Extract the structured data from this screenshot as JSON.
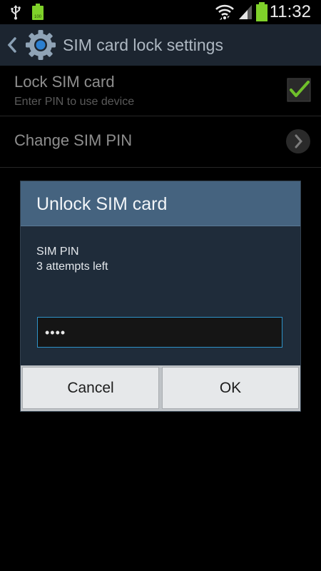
{
  "status_bar": {
    "time": "11:32",
    "icons": [
      "usb-icon",
      "battery-full-icon",
      "wifi-icon",
      "signal-icon",
      "battery-icon"
    ],
    "battery_color": "#7fd12a"
  },
  "action_bar": {
    "title": "SIM card lock settings",
    "icons": [
      "back-icon",
      "settings-gear-icon"
    ]
  },
  "settings": {
    "items": [
      {
        "title": "Lock SIM card",
        "summary": "Enter PIN to use device",
        "checked": true
      },
      {
        "title": "Change SIM PIN"
      }
    ]
  },
  "dialog": {
    "title": "Unlock SIM card",
    "message_line1": "SIM PIN",
    "message_line2": "3 attempts left",
    "pin_value": "••••",
    "cancel_label": "Cancel",
    "ok_label": "OK"
  },
  "colors": {
    "accent": "#2e93c9",
    "dialog_header": "#45637f",
    "dialog_body": "#1f2c3a",
    "check_green": "#6fbf2a"
  }
}
